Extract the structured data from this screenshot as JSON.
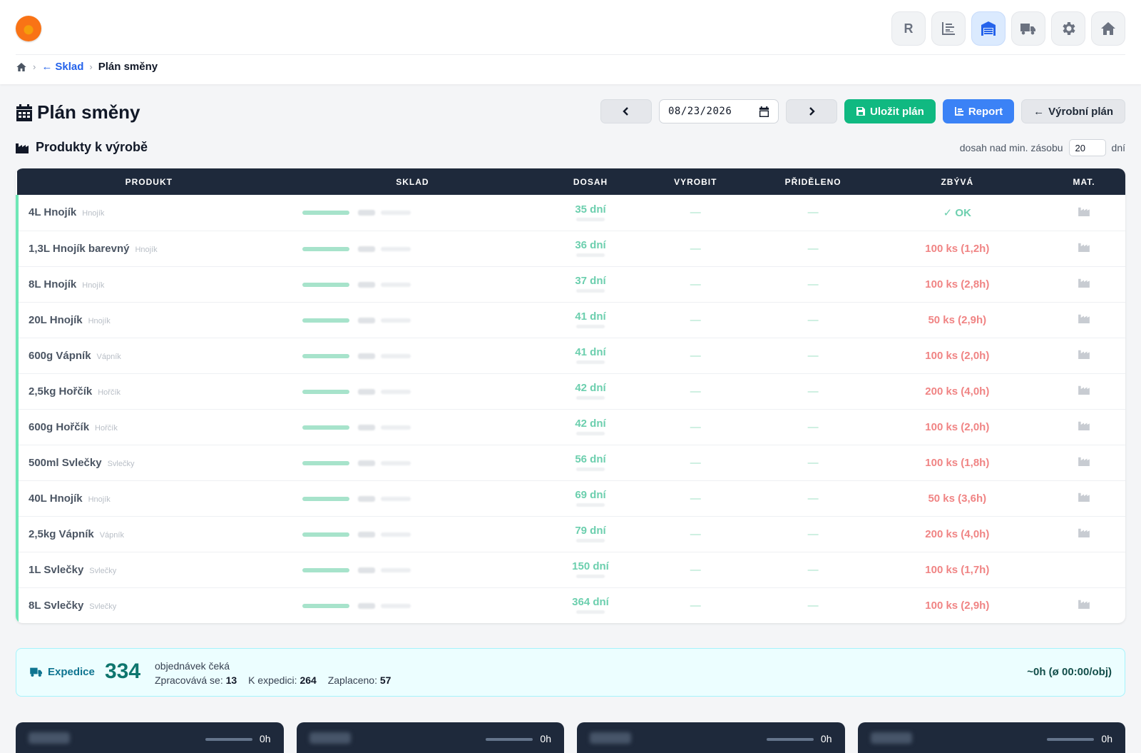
{
  "nav": {
    "items": [
      {
        "icon": "letter-r-icon",
        "label": "R",
        "active": false
      },
      {
        "icon": "chart-icon",
        "label": "",
        "active": false
      },
      {
        "icon": "warehouse-icon",
        "label": "",
        "active": true
      },
      {
        "icon": "truck-icon",
        "label": "",
        "active": false
      },
      {
        "icon": "gear-icon",
        "label": "",
        "active": false
      },
      {
        "icon": "home-icon",
        "label": "",
        "active": false
      }
    ]
  },
  "breadcrumb": {
    "home_icon": "home-icon",
    "parent": "Sklad",
    "current": "Plán směny"
  },
  "page": {
    "title": "Plán směny",
    "date": "08/23/2026",
    "save_label": "Uložit plán",
    "report_label": "Report",
    "production_plan_label": "Výrobní plán"
  },
  "products_section": {
    "title": "Produkty k výrobě",
    "reach_label": "dosah nad min. zásobu",
    "reach_value": "20",
    "reach_unit": "dní"
  },
  "table": {
    "headers": [
      "PRODUKT",
      "SKLAD",
      "DOSAH",
      "VYROBIT",
      "PŘIDĚLENO",
      "ZBÝVÁ",
      "MAT."
    ],
    "rows": [
      {
        "name": "4L Hnojík",
        "category": "Hnojík",
        "reach": "35 dní",
        "produce": "—",
        "assigned": "—",
        "remaining": "OK",
        "ok": true
      },
      {
        "name": "1,3L Hnojík barevný",
        "category": "Hnojík",
        "reach": "36 dní",
        "produce": "—",
        "assigned": "—",
        "remaining": "100 ks (1,2h)",
        "ok": false
      },
      {
        "name": "8L Hnojík",
        "category": "Hnojík",
        "reach": "37 dní",
        "produce": "—",
        "assigned": "—",
        "remaining": "100 ks (2,8h)",
        "ok": false
      },
      {
        "name": "20L Hnojík",
        "category": "Hnojík",
        "reach": "41 dní",
        "produce": "—",
        "assigned": "—",
        "remaining": "50 ks (2,9h)",
        "ok": false
      },
      {
        "name": "600g Vápník",
        "category": "Vápník",
        "reach": "41 dní",
        "produce": "—",
        "assigned": "—",
        "remaining": "100 ks (2,0h)",
        "ok": false
      },
      {
        "name": "2,5kg Hořčík",
        "category": "Hořčík",
        "reach": "42 dní",
        "produce": "—",
        "assigned": "—",
        "remaining": "200 ks (4,0h)",
        "ok": false
      },
      {
        "name": "600g Hořčík",
        "category": "Hořčík",
        "reach": "42 dní",
        "produce": "—",
        "assigned": "—",
        "remaining": "100 ks (2,0h)",
        "ok": false
      },
      {
        "name": "500ml Svlečky",
        "category": "Svlečky",
        "reach": "56 dní",
        "produce": "—",
        "assigned": "—",
        "remaining": "100 ks (1,8h)",
        "ok": false
      },
      {
        "name": "40L Hnojík",
        "category": "Hnojík",
        "reach": "69 dní",
        "produce": "—",
        "assigned": "—",
        "remaining": "50 ks (3,6h)",
        "ok": false
      },
      {
        "name": "2,5kg Vápník",
        "category": "Vápník",
        "reach": "79 dní",
        "produce": "—",
        "assigned": "—",
        "remaining": "200 ks (4,0h)",
        "ok": false
      },
      {
        "name": "1L Svlečky",
        "category": "Svlečky",
        "reach": "150 dní",
        "produce": "—",
        "assigned": "—",
        "remaining": "100 ks (1,7h)",
        "ok": false
      },
      {
        "name": "8L Svlečky",
        "category": "Svlečky",
        "reach": "364 dní",
        "produce": "—",
        "assigned": "—",
        "remaining": "100 ks (2,9h)",
        "ok": false
      }
    ]
  },
  "expedice": {
    "label": "Expedice",
    "count": "334",
    "description": "objednávek čeká",
    "processing_label": "Zpracovává se:",
    "processing_value": "13",
    "to_ship_label": "K expedici:",
    "to_ship_value": "264",
    "paid_label": "Zaplaceno:",
    "paid_value": "57",
    "time_summary": "~0h (ø 00:00/obj)"
  },
  "cards": [
    {
      "hours": "0h"
    },
    {
      "hours": "0h"
    },
    {
      "hours": "0h"
    },
    {
      "hours": "0h"
    }
  ],
  "colors": {
    "accent_blue": "#3b82f6",
    "accent_green": "#10b981",
    "table_header": "#1e293b",
    "reach_green": "#6ccfae",
    "remaining_red": "#f08484",
    "expedice_bg": "#ecfeff"
  }
}
